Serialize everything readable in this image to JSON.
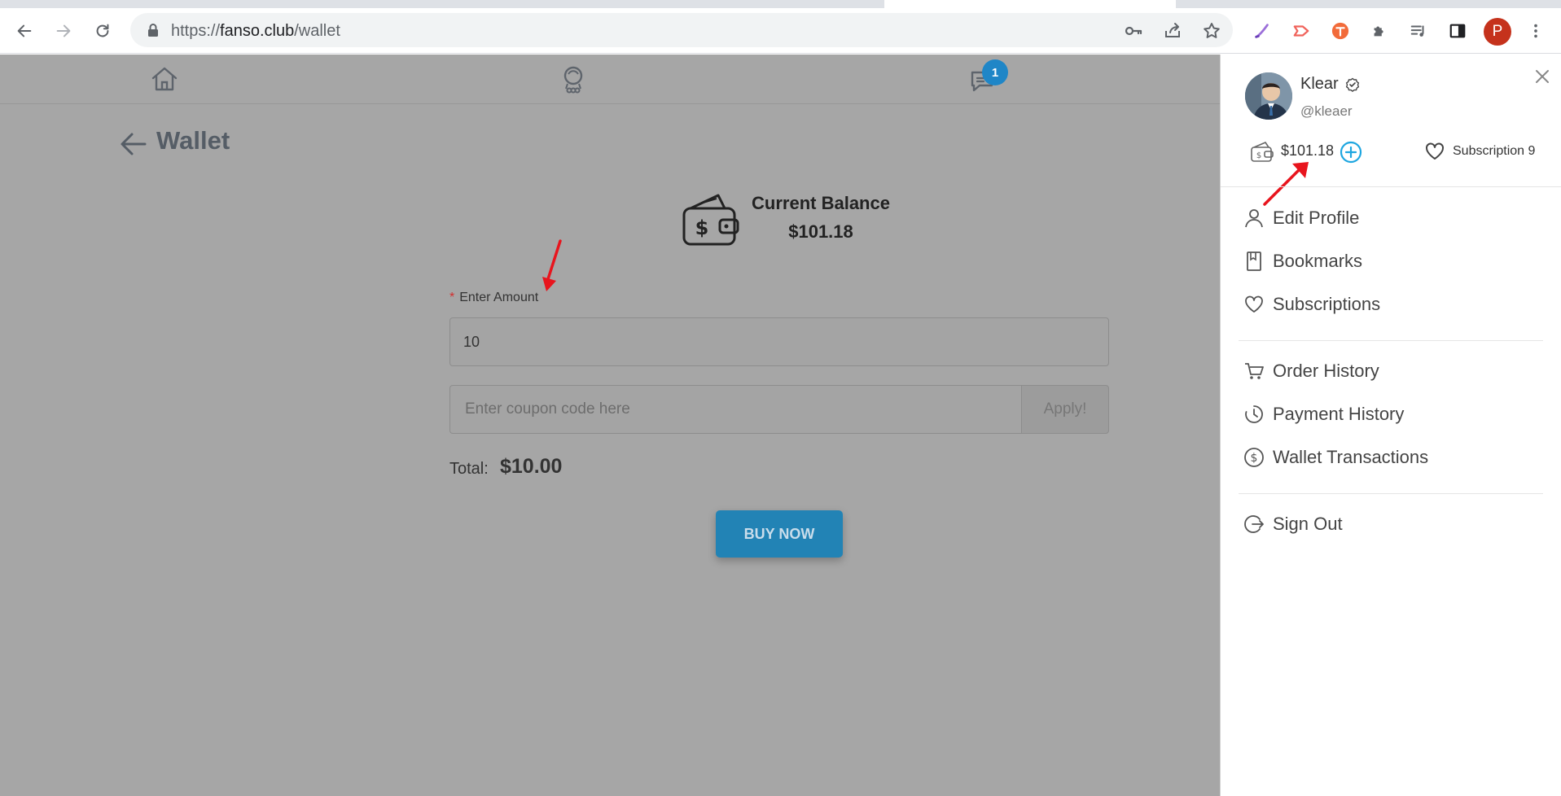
{
  "browser": {
    "url_scheme": "https://",
    "url_host": "fanso.club",
    "url_path": "/wallet",
    "profile_initial": "P"
  },
  "nav": {
    "message_badge": "1"
  },
  "page": {
    "title": "Wallet",
    "balance_label": "Current Balance",
    "balance_value": "$101.18",
    "amount_label": "Enter Amount",
    "amount_value": "10",
    "coupon_placeholder": "Enter coupon code here",
    "apply_label": "Apply!",
    "total_label": "Total:",
    "total_value": "$10.00",
    "buy_label": "BUY NOW"
  },
  "drawer": {
    "user_name": "Klear",
    "user_handle": "@kleaer",
    "wallet_balance": "$101.18",
    "subscription_label": "Subscription 9",
    "menu_group_1": [
      {
        "label": "Edit Profile",
        "icon": "user-icon"
      },
      {
        "label": "Bookmarks",
        "icon": "bookmark-icon"
      },
      {
        "label": "Subscriptions",
        "icon": "heart-icon"
      }
    ],
    "menu_group_2": [
      {
        "label": "Order History",
        "icon": "cart-icon"
      },
      {
        "label": "Payment History",
        "icon": "history-icon"
      },
      {
        "label": "Wallet Transactions",
        "icon": "dollar-circle-icon"
      }
    ],
    "menu_group_3": [
      {
        "label": "Sign Out",
        "icon": "sign-out-icon"
      }
    ]
  },
  "colors": {
    "overlay": "#a6a6a6",
    "accent": "#2283b5",
    "badge": "#1f86c7",
    "annotation": "#e8141d"
  }
}
